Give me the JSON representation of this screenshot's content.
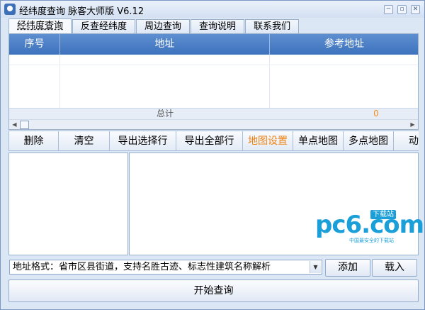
{
  "window": {
    "title": "经纬度查询 脉客大师版 V6.12",
    "controls": {
      "minimize": "─",
      "restore": "▫",
      "close": "✕"
    }
  },
  "tabs": [
    {
      "label": "经纬度查询",
      "active": true
    },
    {
      "label": "反查经纬度",
      "active": false
    },
    {
      "label": "周边查询",
      "active": false
    },
    {
      "label": "查询说明",
      "active": false
    },
    {
      "label": "联系我们",
      "active": false
    }
  ],
  "table": {
    "headers": [
      "序号",
      "地址",
      "参考地址"
    ],
    "total_label": "总计",
    "total_value": "0"
  },
  "toolbar": {
    "buttons": [
      "删除",
      "清空",
      "导出选择行",
      "导出全部行",
      "地图设置",
      "单点地图",
      "多点地图",
      "动态"
    ],
    "highlighted": "地图设置"
  },
  "watermark": {
    "brand": "pc6.com",
    "badge": "下载站",
    "tagline": "中国最安全的下载站"
  },
  "address": {
    "value": "地址格式：省市区县街道，支持名胜古迹、标志性建筑名称解析"
  },
  "buttons": {
    "add": "添加",
    "load": "载入",
    "start": "开始查询"
  },
  "colors": {
    "header_blue": "#4a7fc6",
    "highlight_orange": "#ef8414",
    "watermark_blue": "#1a9fd9"
  }
}
